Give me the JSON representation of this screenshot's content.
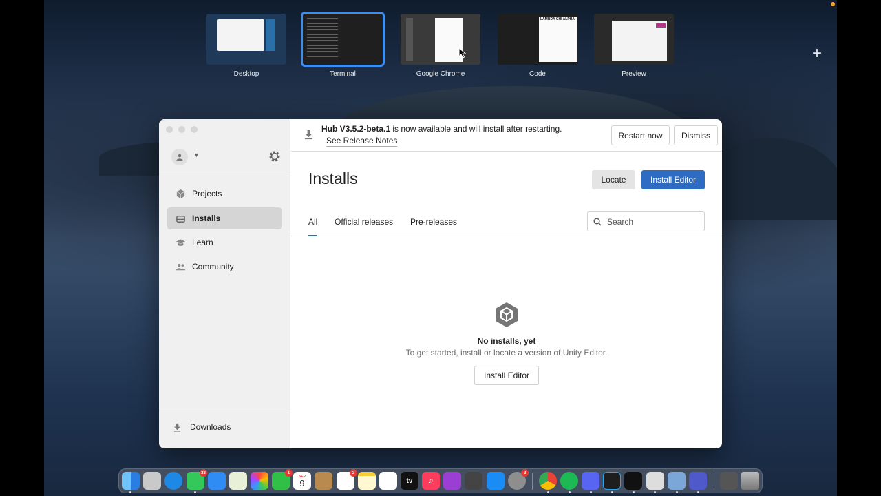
{
  "spaces": [
    {
      "label": "Desktop"
    },
    {
      "label": "Terminal"
    },
    {
      "label": "Google Chrome"
    },
    {
      "label": "Code"
    },
    {
      "label": "Preview"
    }
  ],
  "code_thumb_text": "LAMBDA CHI ALPHA",
  "update_banner": {
    "version": "Hub V3.5.2-beta.1",
    "message": " is now available and will install after restarting.",
    "release_notes": "See Release Notes",
    "restart_label": "Restart now",
    "dismiss_label": "Dismiss"
  },
  "sidebar": {
    "items": [
      {
        "label": "Projects"
      },
      {
        "label": "Installs"
      },
      {
        "label": "Learn"
      },
      {
        "label": "Community"
      }
    ],
    "downloads_label": "Downloads"
  },
  "main": {
    "title": "Installs",
    "locate_label": "Locate",
    "install_editor_label": "Install Editor",
    "tabs": [
      {
        "label": "All"
      },
      {
        "label": "Official releases"
      },
      {
        "label": "Pre-releases"
      }
    ],
    "search_placeholder": "Search",
    "empty": {
      "heading": "No installs, yet",
      "subtext": "To get started, install or locate a version of Unity Editor.",
      "button_label": "Install Editor"
    }
  },
  "dock": {
    "messages_badge": "33",
    "facetime_badge": "1",
    "calendar_month": "SEP",
    "calendar_day": "9",
    "reminders_badge": "2",
    "settings_badge": "2",
    "tv_label": "tv"
  },
  "colors": {
    "accent": "#2e6cc3",
    "selected_space": "#3d8ef0"
  }
}
